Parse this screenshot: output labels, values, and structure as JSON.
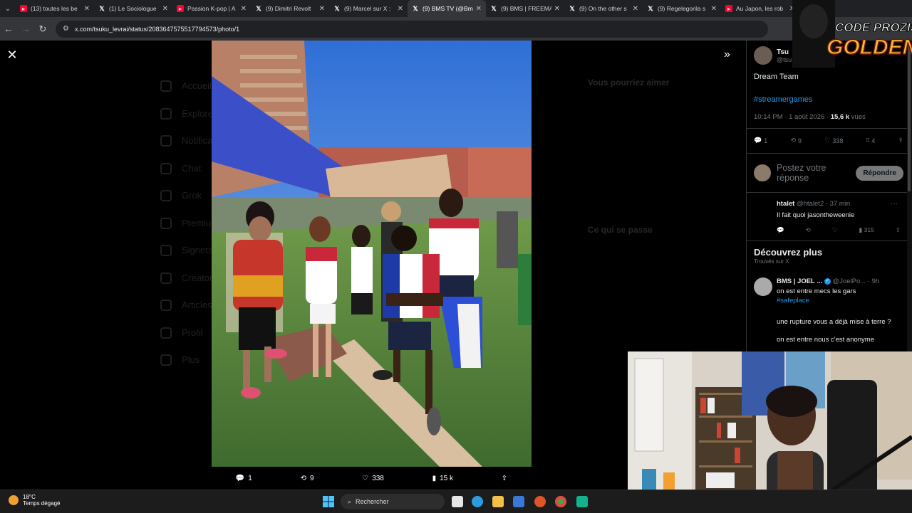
{
  "tabs": [
    {
      "label": "(13) toutes les be",
      "favicon": "youtube-icon",
      "active": false
    },
    {
      "label": "(1) Le Sociologue",
      "favicon": "x-logo-icon",
      "active": false
    },
    {
      "label": "Passion K-pop | A",
      "favicon": "youtube-icon",
      "active": false
    },
    {
      "label": "(9) Dimitri Revolt",
      "favicon": "x-logo-icon",
      "active": false
    },
    {
      "label": "(9) Marcel sur X :",
      "favicon": "x-logo-icon",
      "active": false
    },
    {
      "label": "(9) BMS TV (@Bm",
      "favicon": "x-logo-icon",
      "active": true
    },
    {
      "label": "(9) BMS | FREEMA",
      "favicon": "x-logo-icon",
      "active": false
    },
    {
      "label": "(9) On the other s",
      "favicon": "x-logo-icon",
      "active": false
    },
    {
      "label": "(9) Regelegorila s",
      "favicon": "x-logo-icon",
      "active": false
    },
    {
      "label": "Au Japon, les rob",
      "favicon": "youtube-icon",
      "active": false
    }
  ],
  "address": {
    "url": "x.com/tsuku_levrai/status/2083647575517794573/photo/1"
  },
  "background_nav": [
    "Accueil",
    "Explorer",
    "Notifications",
    "Chat",
    "Grok",
    "Premium",
    "Signets",
    "Creator Studio",
    "Articles",
    "Profil",
    "Plus"
  ],
  "background_right": {
    "heading": "Vous pourriez aimer",
    "heading2": "Ce qui se passe"
  },
  "photo_actions": {
    "replies": "1",
    "reposts": "9",
    "likes": "338",
    "views": "15 k"
  },
  "tweet": {
    "author_name": "Tsu",
    "author_handle": "@tsu",
    "text": "Dream Team",
    "hashtag": "#streamergames",
    "time": "10:14 PM · 1 août 2026 · ",
    "views_count": "15,6 k",
    "views_label": " vues",
    "actions": {
      "replies": "1",
      "reposts": "9",
      "likes": "338",
      "bookmarks": "4"
    }
  },
  "reply_box": {
    "placeholder": "Postez votre réponse",
    "button": "Répondre"
  },
  "reply": {
    "username": "htalet",
    "handle": "@htalet2 · 37 min",
    "text": "Il fait quoi jasontheweenie",
    "views": "315"
  },
  "discover": {
    "title": "Découvrez plus",
    "subtitle": "Trouvés sur X",
    "post": {
      "name": "BMS | JOEL ...",
      "handle": "@JoelPo... · 9h",
      "line1": "on est entre mecs les gars",
      "hashtag": "#safeplace",
      "line2": "une rupture vous a déjà mise à terre ?",
      "line3": "on est entre nous c'est anonyme"
    }
  },
  "overlay_logo": {
    "line1": "CODE PROZIS",
    "line2": "GOLDENG"
  },
  "taskbar": {
    "temp": "18°C",
    "weather": "Temps dégagé",
    "search_placeholder": "Rechercher"
  },
  "colors": {
    "accent": "#1d9bf0",
    "chrome_dark": "#202124",
    "chrome": "#35363a"
  }
}
